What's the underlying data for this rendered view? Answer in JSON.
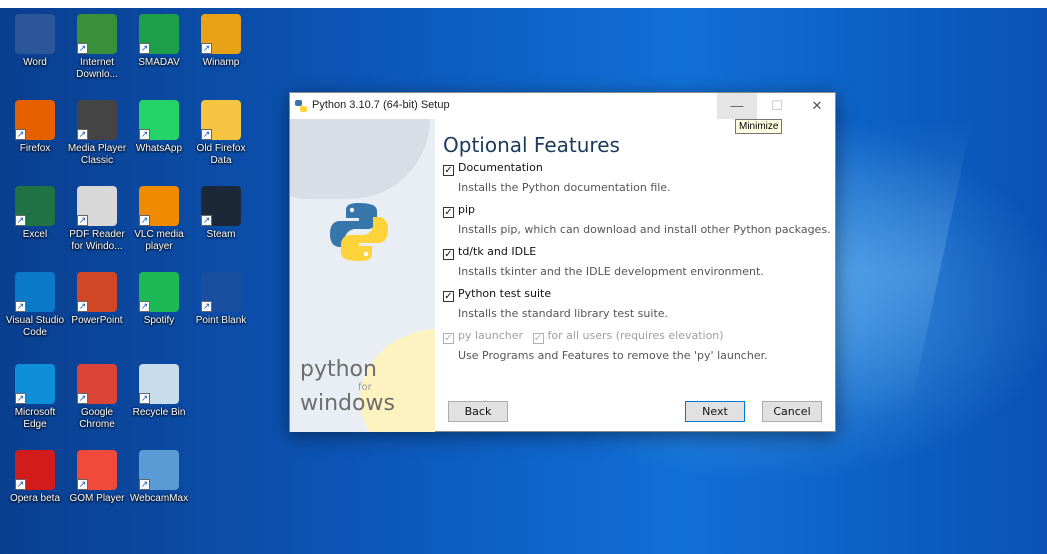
{
  "desktop": {
    "icons": [
      {
        "label": "Word",
        "icon": "word-icon",
        "color": "#2b579a"
      },
      {
        "label": "Internet Downlo...",
        "icon": "idm-icon",
        "color": "#3a8f3a"
      },
      {
        "label": "SMADAV",
        "icon": "smadav-icon",
        "color": "#1ea04a"
      },
      {
        "label": "Winamp",
        "icon": "winamp-icon",
        "color": "#e8a215"
      },
      {
        "label": "Firefox",
        "icon": "firefox-icon",
        "color": "#e66000"
      },
      {
        "label": "Media Player Classic",
        "icon": "mpc-icon",
        "color": "#444444"
      },
      {
        "label": "WhatsApp",
        "icon": "whatsapp-icon",
        "color": "#25d366"
      },
      {
        "label": "Old Firefox Data",
        "icon": "folder-icon",
        "color": "#f5c542"
      },
      {
        "label": "Excel",
        "icon": "excel-icon",
        "color": "#217346"
      },
      {
        "label": "PDF Reader for Windo...",
        "icon": "pdf-icon",
        "color": "#d8d8d8"
      },
      {
        "label": "VLC media player",
        "icon": "vlc-icon",
        "color": "#f08a00"
      },
      {
        "label": "Steam",
        "icon": "steam-icon",
        "color": "#1b2838"
      },
      {
        "label": "Visual Studio Code",
        "icon": "vscode-icon",
        "color": "#0a7ac8"
      },
      {
        "label": "PowerPoint",
        "icon": "powerpoint-icon",
        "color": "#d24726"
      },
      {
        "label": "Spotify",
        "icon": "spotify-icon",
        "color": "#1db954"
      },
      {
        "label": "Point Blank",
        "icon": "pointblank-icon",
        "color": "#1a4fa0"
      },
      {
        "label": "Microsoft Edge",
        "icon": "edge-icon",
        "color": "#0f8fd8"
      },
      {
        "label": "Google Chrome",
        "icon": "chrome-icon",
        "color": "#db4437"
      },
      {
        "label": "Recycle Bin",
        "icon": "recycle-bin-icon",
        "color": "#c9dceb"
      },
      {
        "label": "Opera beta",
        "icon": "opera-icon",
        "color": "#d21c1c"
      },
      {
        "label": "GOM Player",
        "icon": "gom-icon",
        "color": "#f04a3a"
      },
      {
        "label": "WebcamMax",
        "icon": "webcam-icon",
        "color": "#5a9bd5"
      }
    ]
  },
  "window": {
    "title": "Python 3.10.7 (64-bit) Setup",
    "minimize": "—",
    "maximize": "☐",
    "close": "✕",
    "tooltip": "Minimize",
    "sidebar": {
      "brand_line1": "python",
      "brand_line2": "for",
      "brand_line3": "windows"
    },
    "heading": "Optional Features",
    "options": [
      {
        "label": "Documentation",
        "desc": "Installs the Python documentation file.",
        "checked": true
      },
      {
        "label": "pip",
        "desc": "Installs pip, which can download and install other Python packages.",
        "checked": true
      },
      {
        "label": "td/tk and IDLE",
        "desc": "Installs tkinter and the IDLE development environment.",
        "checked": true
      },
      {
        "label": "Python test suite",
        "desc": "Installs the standard library test suite.",
        "checked": true
      }
    ],
    "launcher": {
      "label": "py launcher",
      "all_users": "for all users (requires elevation)",
      "desc": "Use Programs and Features to remove the 'py' launcher."
    },
    "buttons": {
      "back": "Back",
      "next": "Next",
      "cancel": "Cancel"
    },
    "check_glyph": "✓"
  }
}
